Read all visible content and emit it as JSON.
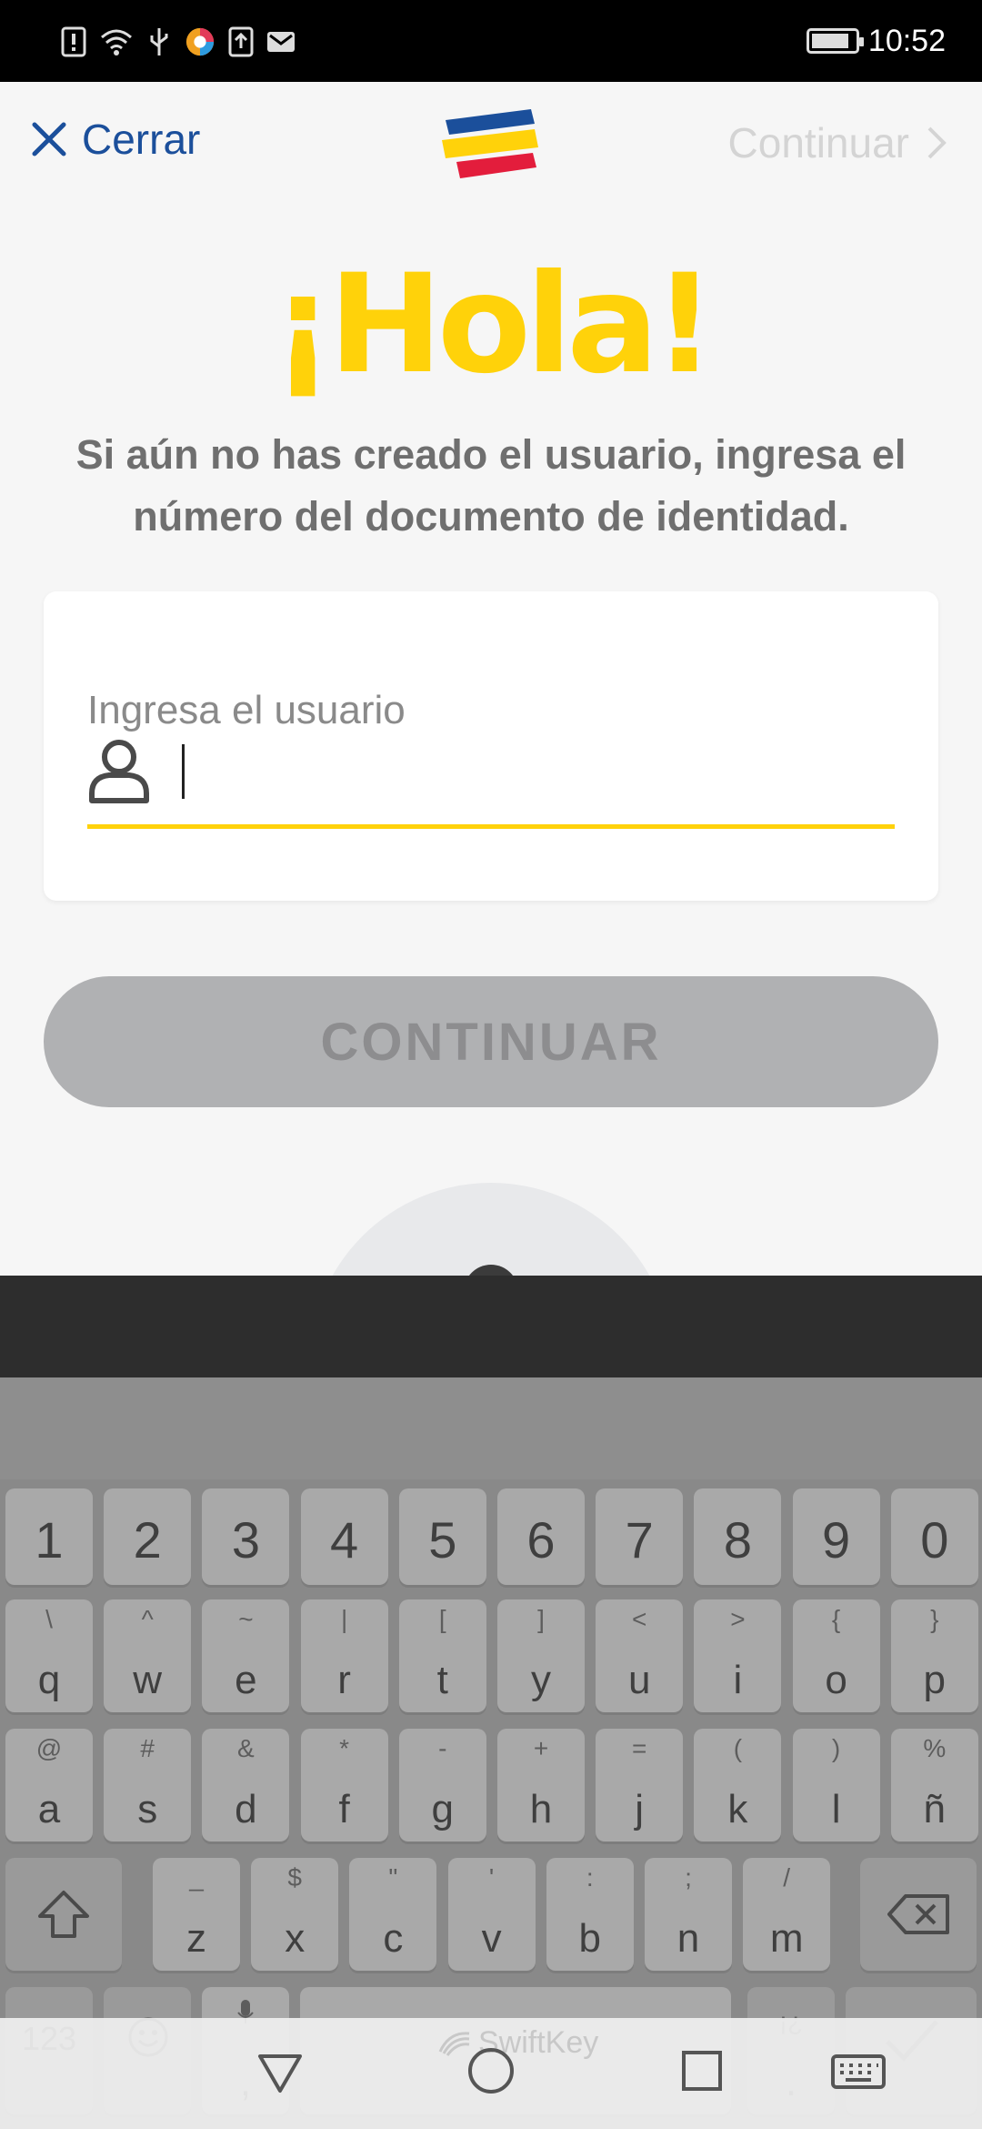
{
  "status_bar": {
    "time": "10:52"
  },
  "header": {
    "close_label": "Cerrar",
    "continue_label": "Continuar"
  },
  "main": {
    "greeting": "¡Hola!",
    "subtitle": "Si aún no has creado el usuario, ingresa el número del documento de identidad.",
    "field_label": "Ingresa el usuario",
    "field_value": "",
    "continue_button": "CONTINUAR"
  },
  "keyboard": {
    "number_row": [
      "1",
      "2",
      "3",
      "4",
      "5",
      "6",
      "7",
      "8",
      "9",
      "0"
    ],
    "row1": [
      {
        "main": "q",
        "alt": "\\"
      },
      {
        "main": "w",
        "alt": "^"
      },
      {
        "main": "e",
        "alt": "~"
      },
      {
        "main": "r",
        "alt": "|"
      },
      {
        "main": "t",
        "alt": "["
      },
      {
        "main": "y",
        "alt": "]"
      },
      {
        "main": "u",
        "alt": "<"
      },
      {
        "main": "i",
        "alt": ">"
      },
      {
        "main": "o",
        "alt": "{"
      },
      {
        "main": "p",
        "alt": "}"
      }
    ],
    "row2": [
      {
        "main": "a",
        "alt": "@"
      },
      {
        "main": "s",
        "alt": "#"
      },
      {
        "main": "d",
        "alt": "&"
      },
      {
        "main": "f",
        "alt": "*"
      },
      {
        "main": "g",
        "alt": "-"
      },
      {
        "main": "h",
        "alt": "+"
      },
      {
        "main": "j",
        "alt": "="
      },
      {
        "main": "k",
        "alt": "("
      },
      {
        "main": "l",
        "alt": ")"
      },
      {
        "main": "ñ",
        "alt": "%"
      }
    ],
    "row3": [
      {
        "main": "z",
        "alt": "_"
      },
      {
        "main": "x",
        "alt": "$"
      },
      {
        "main": "c",
        "alt": "\""
      },
      {
        "main": "v",
        "alt": "'"
      },
      {
        "main": "b",
        "alt": ":"
      },
      {
        "main": "n",
        "alt": ";"
      },
      {
        "main": "m",
        "alt": "/"
      }
    ],
    "bottom": {
      "symbols_label": "123",
      "comma": ",",
      "period": ".",
      "inverted_q": "¡¿",
      "brand": "SwiftKey"
    }
  },
  "icons": [
    "close-icon",
    "chevron-right-icon",
    "user-icon",
    "shift-icon",
    "backspace-icon",
    "emoji-icon",
    "mic-icon",
    "check-icon",
    "back-icon",
    "home-icon",
    "recents-icon",
    "keyboard-icon"
  ],
  "colors": {
    "brand_blue": "#1b4f9b",
    "brand_yellow": "#ffd20a",
    "brand_red": "#e31d3c",
    "button_disabled": "#b0b1b3"
  }
}
